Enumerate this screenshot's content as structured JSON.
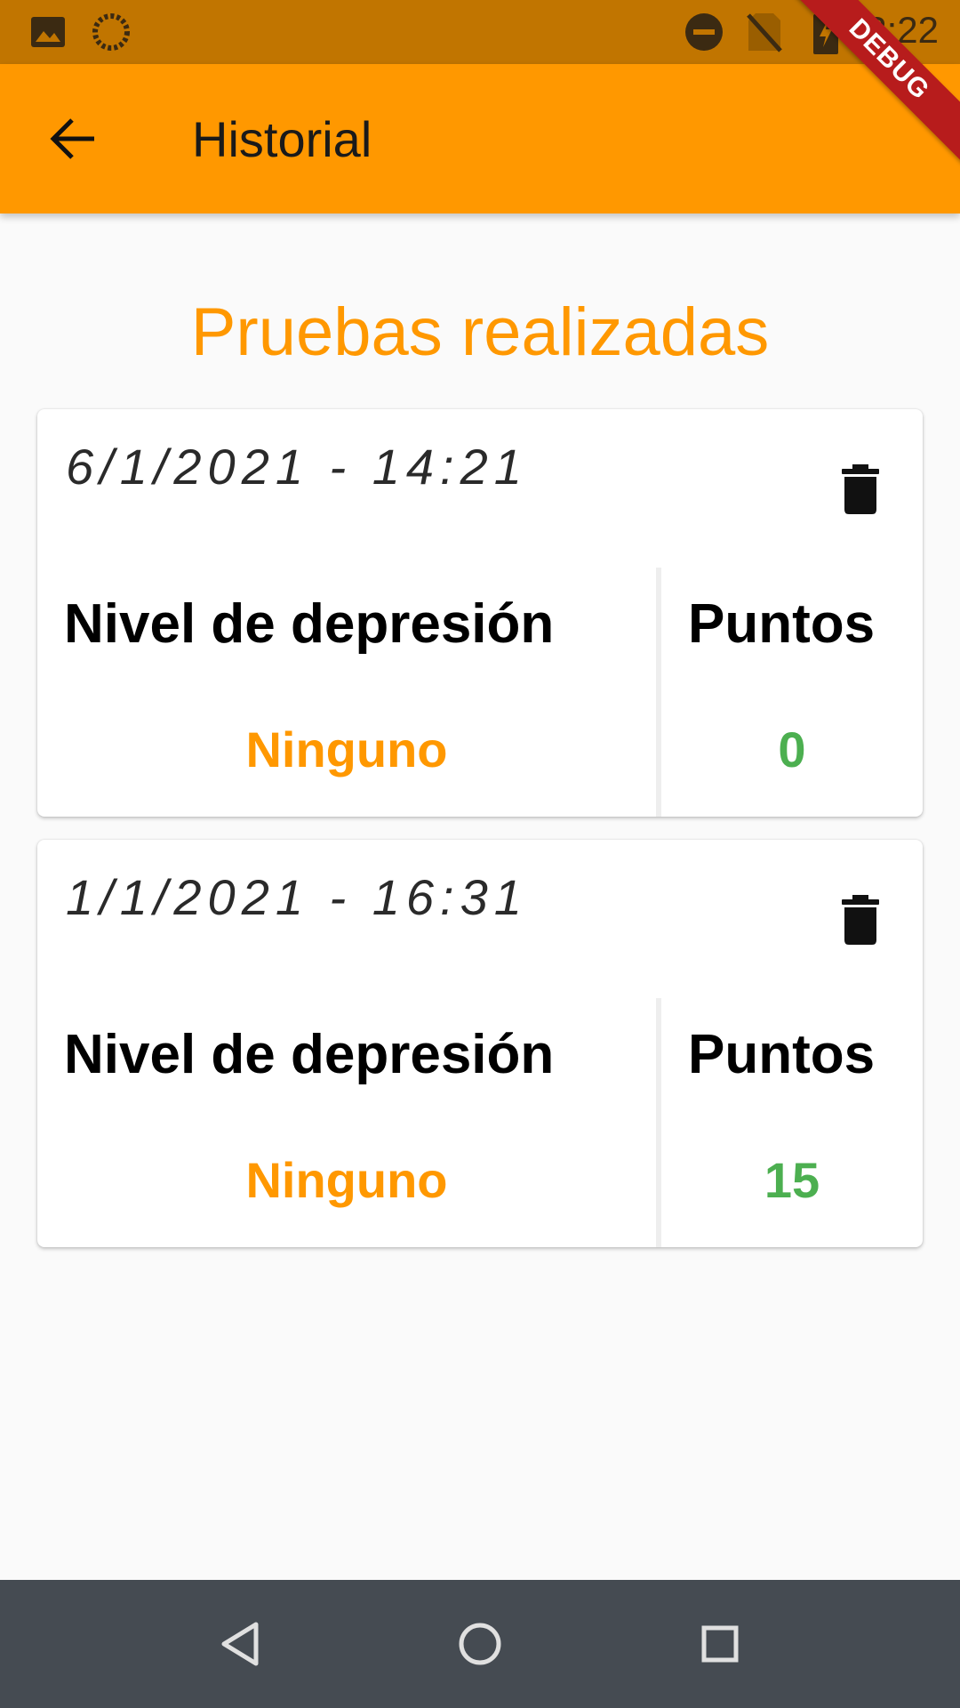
{
  "status_bar": {
    "time": "2:22",
    "icons": [
      "image-icon",
      "sync-icon",
      "do-not-disturb-icon",
      "no-sim-icon",
      "battery-charging-icon"
    ]
  },
  "app_bar": {
    "title": "Historial",
    "back_icon": "arrow-back-icon"
  },
  "debug_banner": "DEBUG",
  "main": {
    "section_title": "Pruebas realizadas",
    "level_header": "Nivel de depresión",
    "points_header": "Puntos",
    "records": [
      {
        "date": "6/1/2021 - 14:21",
        "level": "Ninguno",
        "points": "0"
      },
      {
        "date": "1/1/2021 - 16:31",
        "level": "Ninguno",
        "points": "15"
      }
    ]
  },
  "nav_bar": {
    "buttons": [
      "back-triangle-icon",
      "home-circle-icon",
      "recents-square-icon"
    ]
  },
  "colors": {
    "primary": "#ff9800",
    "status_bar": "#c17500",
    "level_text": "#ff9800",
    "points_text": "#4caf50",
    "nav_bar": "#454b52"
  }
}
